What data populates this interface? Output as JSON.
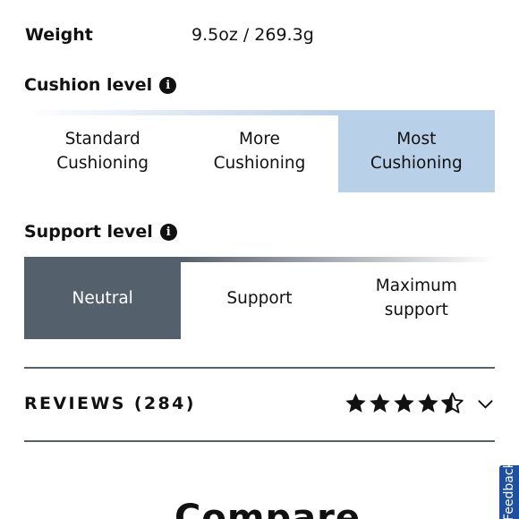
{
  "spec": {
    "label": "Weight",
    "value": "9.5oz / 269.3g"
  },
  "cushion": {
    "heading": "Cushion level",
    "info_icon": "info-icon",
    "options": [
      {
        "line1": "Standard",
        "line2": "Cushioning"
      },
      {
        "line1": "More",
        "line2": "Cushioning"
      },
      {
        "line1": "Most",
        "line2": "Cushioning"
      }
    ],
    "selected": "Most Cushioning",
    "selected_color": "#b9d0e9"
  },
  "support": {
    "heading": "Support level",
    "info_icon": "info-icon",
    "options": [
      {
        "line1": "Neutral",
        "line2": ""
      },
      {
        "line1": "Support",
        "line2": ""
      },
      {
        "line1": "Maximum",
        "line2": "support"
      }
    ],
    "selected": "Neutral",
    "selected_color": "#55606d"
  },
  "reviews": {
    "title": "REVIEWS (284)",
    "rating": 4.5,
    "max_rating": 5,
    "star_icon": "star-icon",
    "expand_icon": "chevron-down-icon"
  },
  "compare": {
    "title": "Compare"
  },
  "feedback": {
    "label": "Feedback",
    "color": "#1f4fa0"
  },
  "colors": {
    "divider": "#56616e",
    "text": "#111111"
  }
}
